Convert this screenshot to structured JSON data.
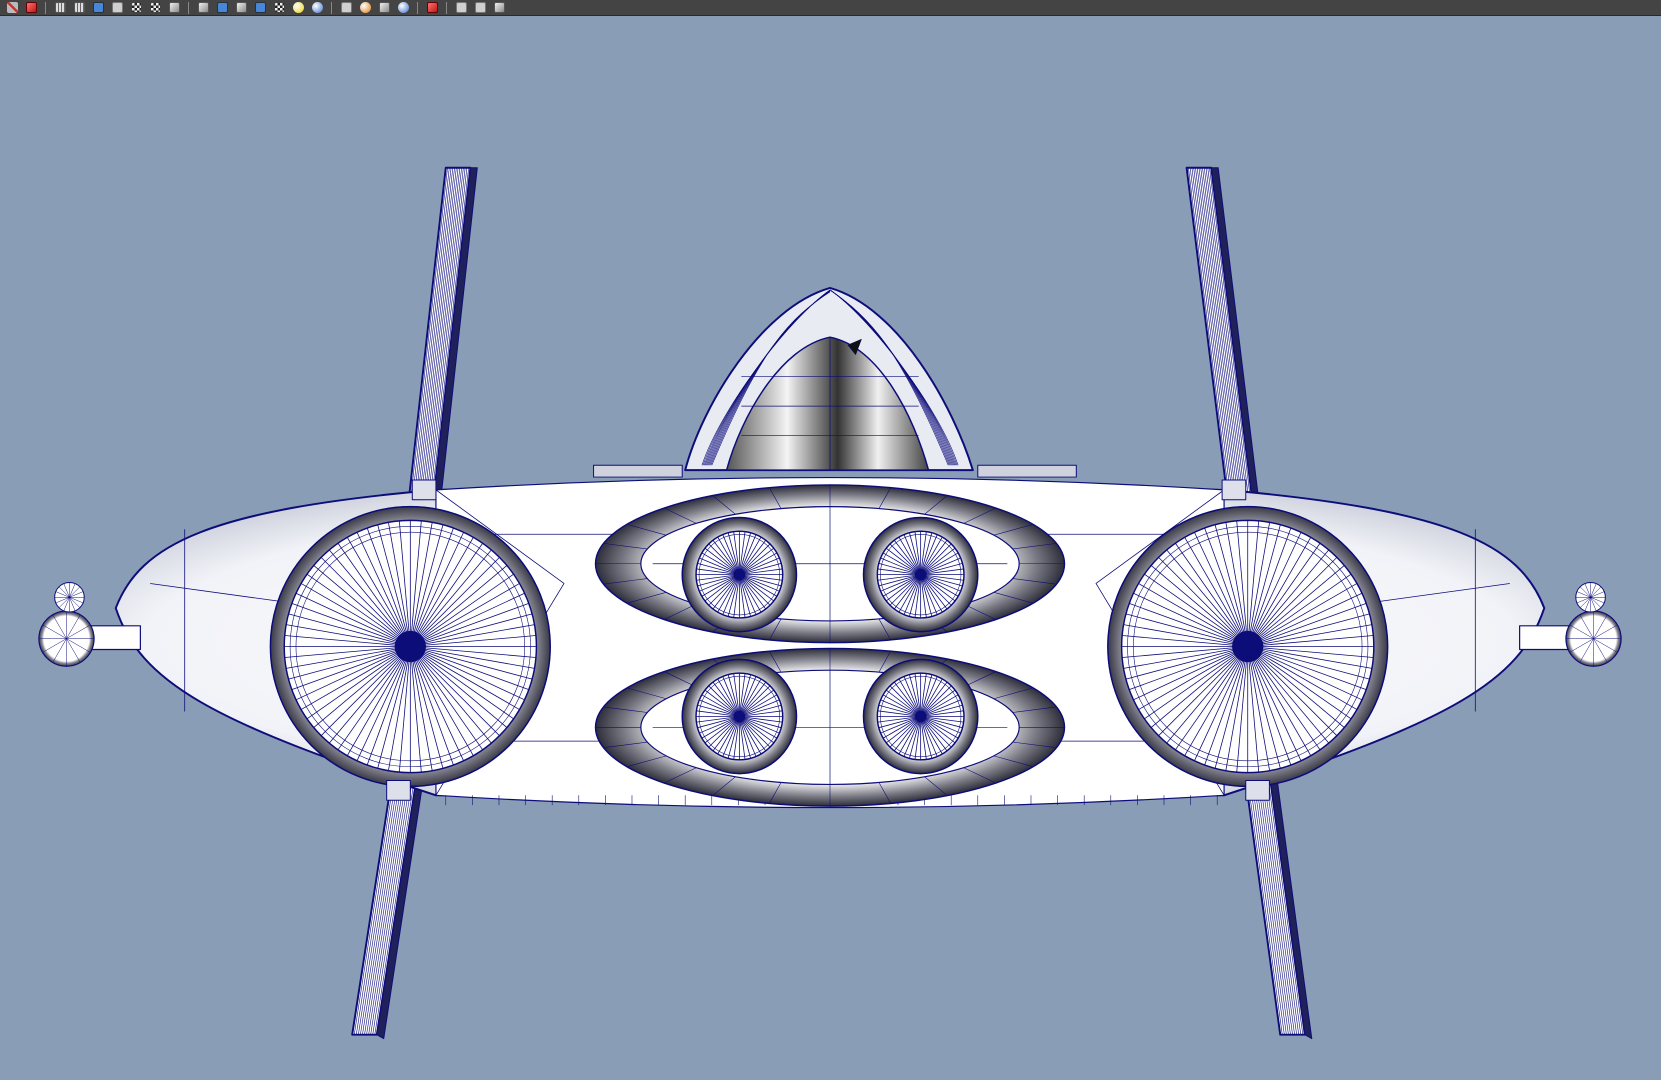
{
  "app": {
    "viewport_background": "#8a9db6",
    "wire_color": "#0d0d7a",
    "toolbar_background": "#444444"
  },
  "toolbar": {
    "groups": [
      [
        {
          "name": "paint-brush-icon",
          "style": "tool"
        },
        {
          "name": "sculpt-tool-icon",
          "style": "red"
        }
      ],
      [
        {
          "name": "layers-icon",
          "style": "grid"
        },
        {
          "name": "uv-grid-icon",
          "style": "grid"
        },
        {
          "name": "material-sphere-icon",
          "style": "blue"
        },
        {
          "name": "white-shade-icon",
          "style": "flat"
        },
        {
          "name": "wireframe-box-icon",
          "style": "chk"
        },
        {
          "name": "texture-checker-icon",
          "style": "chk"
        },
        {
          "name": "info-icon",
          "style": "cube"
        }
      ],
      [
        {
          "name": "shaded-box-icon",
          "style": "cube"
        },
        {
          "name": "blue-box-icon",
          "style": "blue"
        },
        {
          "name": "smooth-shade-icon",
          "style": "cube"
        },
        {
          "name": "xray-box-icon",
          "style": "blue"
        },
        {
          "name": "checker-sphere-icon",
          "style": "chk"
        },
        {
          "name": "light-bulb-icon",
          "style": "ball yellow"
        },
        {
          "name": "environment-sphere-icon",
          "style": "ball"
        }
      ],
      [
        {
          "name": "display-monitor-icon",
          "style": "flat"
        },
        {
          "name": "render-sphere-icon",
          "style": "ball orange"
        },
        {
          "name": "camera-cube-icon",
          "style": "cube"
        },
        {
          "name": "ambient-occlusion-icon",
          "style": "ball"
        }
      ],
      [
        {
          "name": "select-cursor-icon",
          "style": "red"
        }
      ],
      [
        {
          "name": "snapshot-icon",
          "style": "flat"
        },
        {
          "name": "copy-view-icon",
          "style": "flat"
        },
        {
          "name": "settings-gear-icon",
          "style": "cube"
        }
      ]
    ]
  }
}
